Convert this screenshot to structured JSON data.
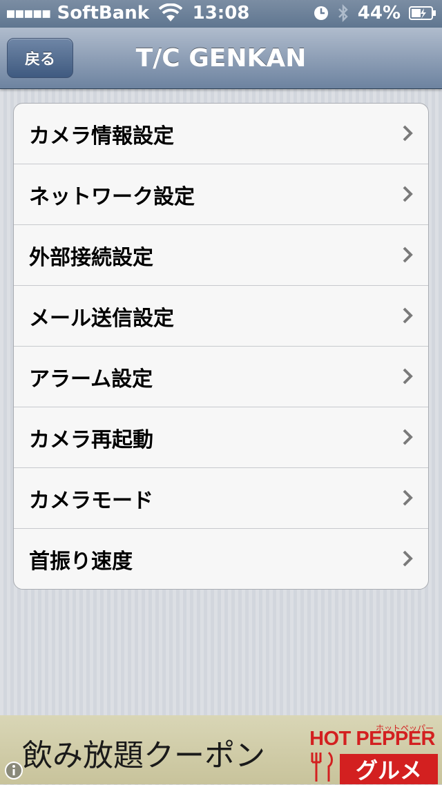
{
  "status_bar": {
    "signal": "▪▪▪▪▪",
    "carrier": "SoftBank",
    "time": "13:08",
    "battery": "44%"
  },
  "nav": {
    "back_label": "戻る",
    "title": "T/C GENKAN"
  },
  "menu": {
    "items": [
      {
        "label": "カメラ情報設定"
      },
      {
        "label": "ネットワーク設定"
      },
      {
        "label": "外部接続設定"
      },
      {
        "label": "メール送信設定"
      },
      {
        "label": "アラーム設定"
      },
      {
        "label": "カメラ再起動"
      },
      {
        "label": "カメラモード"
      },
      {
        "label": "首振り速度"
      }
    ]
  },
  "ad": {
    "text": "飲み放題クーポン",
    "brand_kana": "ホットペッパー",
    "brand_top": "HOT PEPPER",
    "brand_box": "グルメ"
  },
  "colors": {
    "nav_gradient": "#8e9fb6",
    "brand_red": "#d32020"
  }
}
